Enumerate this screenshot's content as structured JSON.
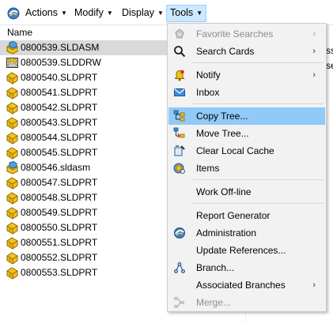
{
  "menubar": {
    "items": [
      {
        "label": "Actions"
      },
      {
        "label": "Modify"
      },
      {
        "label": "Display"
      },
      {
        "label": "Tools"
      }
    ]
  },
  "list": {
    "header": "Name",
    "rows": [
      {
        "label": "0800539.SLDASM",
        "icon": "assembly-icon",
        "selected": true
      },
      {
        "label": "0800539.SLDDRW",
        "icon": "drawing-icon"
      },
      {
        "label": "0800540.SLDPRT",
        "icon": "part-icon"
      },
      {
        "label": "0800541.SLDPRT",
        "icon": "part-icon"
      },
      {
        "label": "0800542.SLDPRT",
        "icon": "part-icon"
      },
      {
        "label": "0800543.SLDPRT",
        "icon": "part-icon"
      },
      {
        "label": "0800544.SLDPRT",
        "icon": "part-icon"
      },
      {
        "label": "0800545.SLDPRT",
        "icon": "part-icon"
      },
      {
        "label": "0800546.sldasm",
        "icon": "assembly-icon"
      },
      {
        "label": "0800547.SLDPRT",
        "icon": "part-icon"
      },
      {
        "label": "0800548.SLDPRT",
        "icon": "part-icon"
      },
      {
        "label": "0800549.SLDPRT",
        "icon": "part-icon"
      },
      {
        "label": "0800550.SLDPRT",
        "icon": "part-icon"
      },
      {
        "label": "0800551.SLDPRT",
        "icon": "part-icon"
      },
      {
        "label": "0800552.SLDPRT",
        "icon": "part-icon"
      },
      {
        "label": "0800553.SLDPRT",
        "icon": "part-icon"
      }
    ]
  },
  "right_fragments": [
    "ss",
    "se"
  ],
  "tools_menu": {
    "items": [
      {
        "label": "Favorite Searches",
        "icon": "favorite-searches-icon",
        "submenu": true,
        "disabled": true
      },
      {
        "label": "Search Cards",
        "icon": "search-icon",
        "submenu": true
      },
      {
        "label": "Notify",
        "icon": "bell-icon",
        "submenu": true
      },
      {
        "label": "Inbox",
        "icon": "inbox-icon"
      },
      {
        "label": "Copy Tree...",
        "icon": "copy-tree-icon",
        "highlighted": true
      },
      {
        "label": "Move Tree...",
        "icon": "move-tree-icon"
      },
      {
        "label": "Clear Local Cache",
        "icon": "clear-cache-icon"
      },
      {
        "label": "Items",
        "icon": "items-icon"
      },
      {
        "label": "Work Off-line",
        "icon": ""
      },
      {
        "label": "Report Generator",
        "icon": ""
      },
      {
        "label": "Administration",
        "icon": "administration-icon"
      },
      {
        "label": "Update References...",
        "icon": ""
      },
      {
        "label": "Branch...",
        "icon": "branch-icon"
      },
      {
        "label": "Associated Branches",
        "icon": "",
        "submenu": true
      },
      {
        "label": "Merge...",
        "icon": "merge-icon",
        "disabled": true
      }
    ]
  },
  "colors": {
    "highlight": "#91c9f7",
    "menu_bg": "#f2f2f2",
    "active_menu": "#cce8ff",
    "part_yellow": "#e8b418",
    "assembly_blue": "#2d8fd5"
  }
}
